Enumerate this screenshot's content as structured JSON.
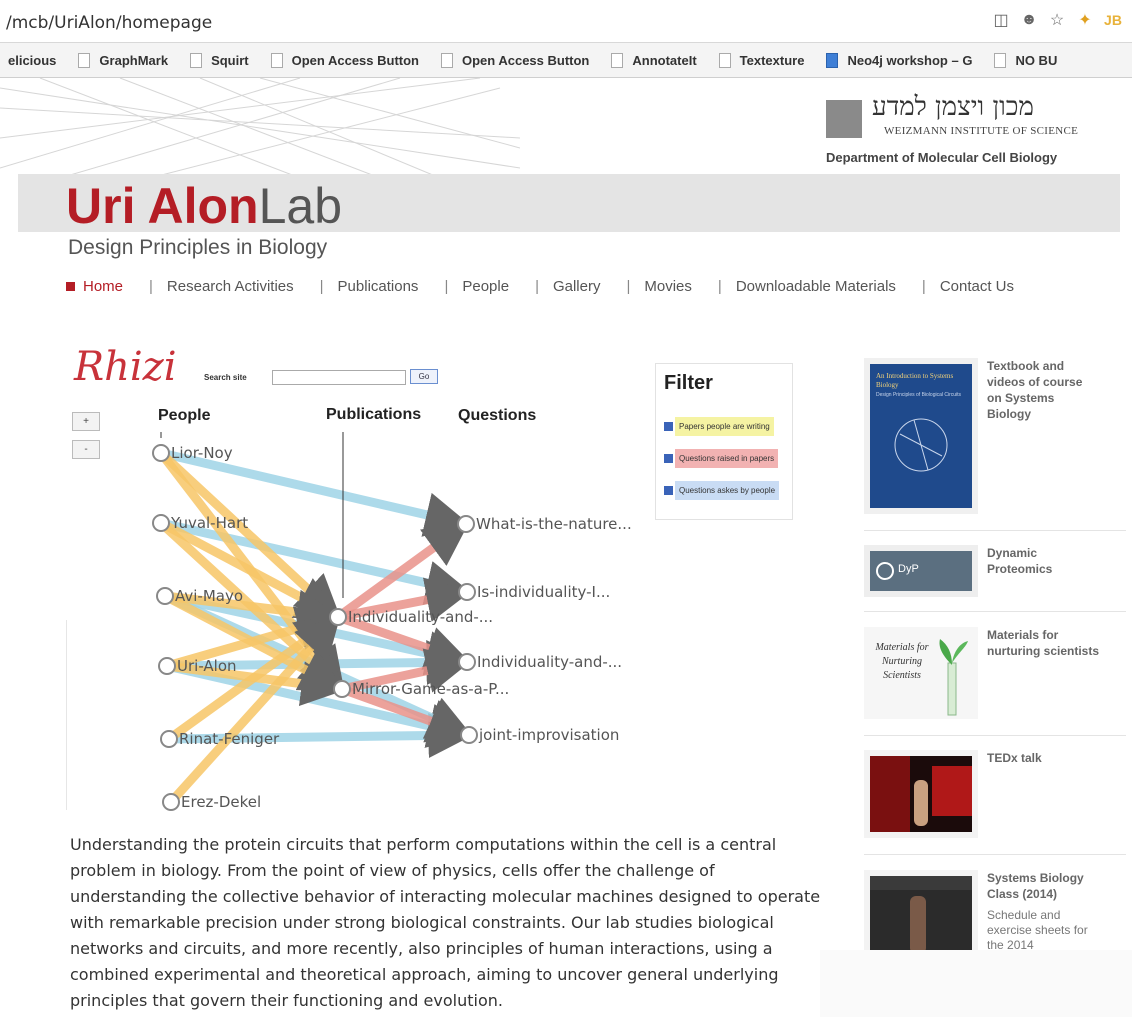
{
  "browser": {
    "url": "/mcb/UriAlon/homepage",
    "bookmarks": [
      "elicious",
      "GraphMark",
      "Squirt",
      "Open Access Button",
      "Open Access Button",
      "AnnotateIt",
      "Textexture",
      "Neo4j workshop – G",
      "NO BU"
    ]
  },
  "header": {
    "institute_hebrew": "מכון ויצמן למדע",
    "institute_english": "WEIZMANN INSTITUTE OF SCIENCE",
    "department": "Department of Molecular Cell Biology",
    "title_bold": "Uri Alon",
    "title_light": "Lab",
    "subtitle": "Design Principles in Biology"
  },
  "nav": {
    "items": [
      "Home",
      "Research Activities",
      "Publications",
      "People",
      "Gallery",
      "Movies",
      "Downloadable Materials",
      "Contact Us"
    ],
    "separator": "|"
  },
  "rhizi": {
    "logo": "Rhizi",
    "search_label": "Search site",
    "search_value": "",
    "go_label": "Go",
    "zoom_in": "+",
    "zoom_out": "-",
    "columns": [
      "People",
      "Publications",
      "Questions"
    ],
    "people": [
      "Lior-Noy",
      "Yuval-Hart",
      "Avi-Mayo",
      "Uri-Alon",
      "Rinat-Feniger",
      "Erez-Dekel"
    ],
    "publications": [
      "Individuality-and-...",
      "Mirror-Game-as-a-P..."
    ],
    "questions": [
      "What-is-the-nature...",
      "Is-individuality-I...",
      "Individuality-and-...",
      "joint-improvisation"
    ],
    "colors": {
      "writing": "#f7c566",
      "raised": "#e9928a",
      "asked": "#9fd3e6"
    }
  },
  "filter": {
    "title": "Filter",
    "items": [
      {
        "label": "Papers people are writing",
        "color": "#f5f3a3"
      },
      {
        "label": "Questions raised in papers",
        "color": "#f2b2b2"
      },
      {
        "label": "Questions askes by people",
        "color": "#c9dcf4"
      }
    ]
  },
  "sidebar": {
    "items": [
      {
        "title": "Textbook and videos of course on Systems Biology",
        "desc": ""
      },
      {
        "title": "Dynamic Proteomics",
        "desc": ""
      },
      {
        "title": "Materials for nurturing scientists",
        "desc": ""
      },
      {
        "title": "TEDx talk",
        "desc": ""
      },
      {
        "title": "Systems Biology Class (2014)",
        "desc": "Schedule and exercise sheets for the 2014"
      }
    ],
    "book_cover_title": "An Introduction to Systems Biology",
    "book_cover_sub": "Design Principles of Biological Circuits",
    "dyp_label": "DyP",
    "materials_label": "Materials for Nurturing Scientists"
  },
  "intro": "Understanding the protein circuits that perform computations within the cell is a central problem in biology. From the point of view of physics, cells offer the challenge of understanding the collective behavior of interacting molecular machines designed to operate with remarkable precision under strong biological constraints. Our lab studies biological networks and circuits, and more recently, also principles of human interactions, using a combined experimental and theoretical approach, aiming to uncover general underlying principles that govern their functioning and evolution."
}
